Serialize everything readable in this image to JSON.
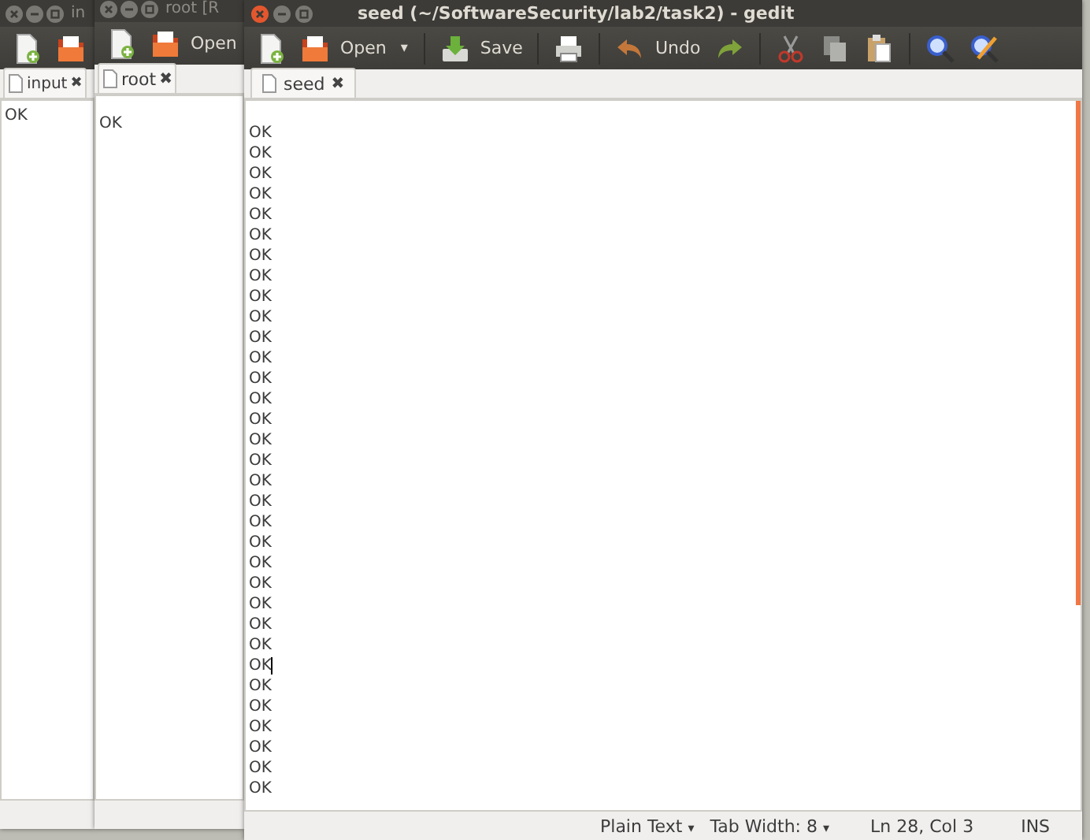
{
  "windows": [
    {
      "title": "in",
      "toolbar": [
        {
          "kind": "new"
        },
        {
          "kind": "open"
        }
      ],
      "tab": {
        "label": "input",
        "close": "✖"
      },
      "lines": [
        {
          "text": "OK",
          "cursor": false
        }
      ]
    },
    {
      "title": "root [R",
      "toolbar": [
        {
          "kind": "new"
        },
        {
          "kind": "open",
          "label": "Open"
        }
      ],
      "tab": {
        "label": "root",
        "close": "✖"
      },
      "lines": [
        {
          "text": "OK",
          "cursor": false
        }
      ]
    },
    {
      "title": "seed (~/SoftwareSecurity/lab2/task2) - gedit",
      "toolbar": [
        {
          "kind": "new"
        },
        {
          "kind": "open",
          "label": "Open"
        },
        {
          "kind": "caret",
          "label": "▾"
        },
        {
          "kind": "sep"
        },
        {
          "kind": "save",
          "label": "Save"
        },
        {
          "kind": "sep"
        },
        {
          "kind": "print"
        },
        {
          "kind": "sep"
        },
        {
          "kind": "undo",
          "label": "Undo"
        },
        {
          "kind": "redo"
        },
        {
          "kind": "sep"
        },
        {
          "kind": "cut"
        },
        {
          "kind": "copy"
        },
        {
          "kind": "paste"
        },
        {
          "kind": "sep"
        },
        {
          "kind": "find"
        },
        {
          "kind": "replace"
        }
      ],
      "tab": {
        "label": "seed",
        "close": "✖"
      },
      "lines": [
        {
          "text": "OK",
          "cursor": false
        },
        {
          "text": "OK",
          "cursor": false
        },
        {
          "text": "OK",
          "cursor": false
        },
        {
          "text": "OK",
          "cursor": false
        },
        {
          "text": "OK",
          "cursor": false
        },
        {
          "text": "OK",
          "cursor": false
        },
        {
          "text": "OK",
          "cursor": false
        },
        {
          "text": "OK",
          "cursor": false
        },
        {
          "text": "OK",
          "cursor": false
        },
        {
          "text": "OK",
          "cursor": false
        },
        {
          "text": "OK",
          "cursor": false
        },
        {
          "text": "OK",
          "cursor": false
        },
        {
          "text": "OK",
          "cursor": false
        },
        {
          "text": "OK",
          "cursor": false
        },
        {
          "text": "OK",
          "cursor": false
        },
        {
          "text": "OK",
          "cursor": false
        },
        {
          "text": "OK",
          "cursor": false
        },
        {
          "text": "OK",
          "cursor": false
        },
        {
          "text": "OK",
          "cursor": false
        },
        {
          "text": "OK",
          "cursor": false
        },
        {
          "text": "OK",
          "cursor": false
        },
        {
          "text": "OK",
          "cursor": false
        },
        {
          "text": "OK",
          "cursor": false
        },
        {
          "text": "OK",
          "cursor": false
        },
        {
          "text": "OK",
          "cursor": false
        },
        {
          "text": "OK",
          "cursor": false
        },
        {
          "text": "OK",
          "cursor": true
        },
        {
          "text": "OK",
          "cursor": false
        },
        {
          "text": "OK",
          "cursor": false
        },
        {
          "text": "OK",
          "cursor": false
        },
        {
          "text": "OK",
          "cursor": false
        },
        {
          "text": "OK",
          "cursor": false
        },
        {
          "text": "OK",
          "cursor": false
        }
      ],
      "status_bar": {
        "language": "Plain Text",
        "tab_width": "Tab Width: 8",
        "position": "Ln 28, Col 3",
        "mode": "INS",
        "caret": "▾"
      }
    }
  ]
}
